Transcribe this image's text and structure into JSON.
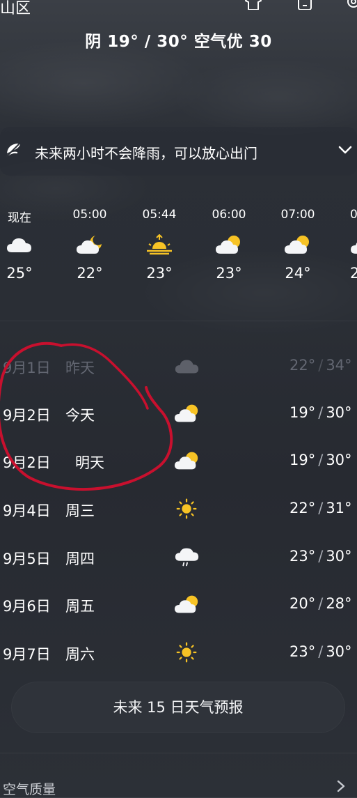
{
  "header": {
    "location": "山区",
    "summary": "阴 19° / 30° 空气优 30",
    "icons": [
      "tshirt-icon",
      "phone-icon",
      "settings-icon"
    ]
  },
  "rain_banner": {
    "icon": "umbrella-off-icon",
    "text": "未来两小时不会降雨，可以放心出门"
  },
  "hourly": [
    {
      "time": "现在",
      "icon": "cloud-icon",
      "temp": "25°"
    },
    {
      "time": "05:00",
      "icon": "cloud-moon-icon",
      "temp": "22°"
    },
    {
      "time": "05:44",
      "icon": "sunrise-icon",
      "temp": "23°"
    },
    {
      "time": "06:00",
      "icon": "cloud-sun-icon",
      "temp": "23°"
    },
    {
      "time": "07:00",
      "icon": "cloud-sun-icon",
      "temp": "24°"
    },
    {
      "time": "0",
      "icon": "cloud-sun-icon",
      "temp": "2"
    }
  ],
  "daily": [
    {
      "date": "9月1日",
      "name": "昨天",
      "icon": "cloud-icon",
      "low": "22°",
      "high": "34°"
    },
    {
      "date": "9月2日",
      "name": "今天",
      "icon": "cloud-sun-icon",
      "low": "19°",
      "high": "30°"
    },
    {
      "date": "9月2日",
      "name": "明天",
      "icon": "cloud-sun-icon",
      "low": "19°",
      "high": "30°"
    },
    {
      "date": "9月4日",
      "name": "周三",
      "icon": "sun-icon",
      "low": "22°",
      "high": "31°"
    },
    {
      "date": "9月5日",
      "name": "周四",
      "icon": "cloud-rain-icon",
      "low": "23°",
      "high": "30°"
    },
    {
      "date": "9月6日",
      "name": "周五",
      "icon": "cloud-sun-icon",
      "low": "20°",
      "high": "28°"
    },
    {
      "date": "9月7日",
      "name": "周六",
      "icon": "sun-icon",
      "low": "23°",
      "high": "30°"
    }
  ],
  "forecast_button": "未来 15 日天气预报",
  "air_quality_label": "空气质量",
  "colors": {
    "sun": "#f7c325",
    "cloud": "#f4f5f7",
    "annotation": "#c8102e"
  }
}
